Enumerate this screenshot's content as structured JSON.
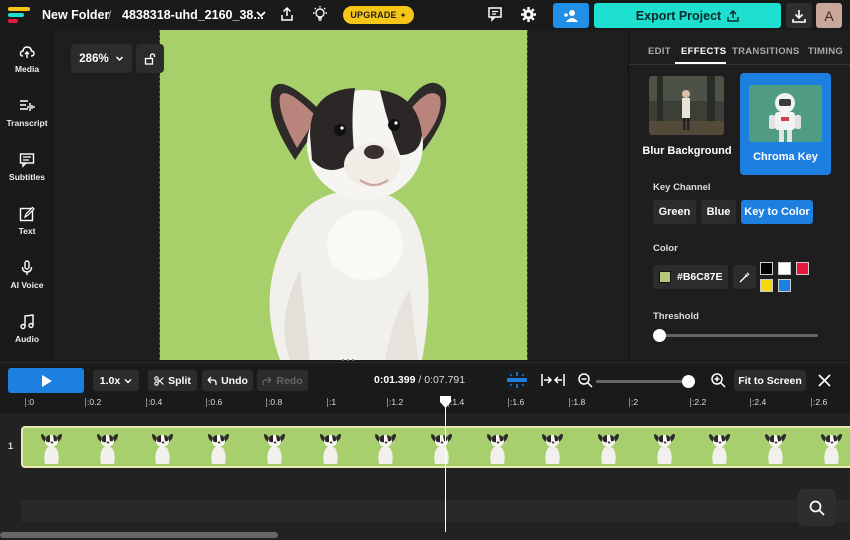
{
  "topbar": {
    "folder": "New Folder",
    "separator": "/",
    "filename": "4838318-uhd_2160_38...",
    "upgrade": "UPGRADE",
    "export": "Export Project",
    "avatar_initial": "A"
  },
  "sidebar": {
    "items": [
      {
        "label": "Media",
        "icon": "upload-cloud-icon"
      },
      {
        "label": "Transcript",
        "icon": "transcript-icon"
      },
      {
        "label": "Subtitles",
        "icon": "subtitles-icon"
      },
      {
        "label": "Text",
        "icon": "text-edit-icon"
      },
      {
        "label": "AI Voice",
        "icon": "microphone-icon"
      },
      {
        "label": "Audio",
        "icon": "music-note-icon"
      }
    ]
  },
  "canvas": {
    "zoom": "286%"
  },
  "panel": {
    "tabs": [
      "EDIT",
      "EFFECTS",
      "TRANSITIONS",
      "TIMING"
    ],
    "active_tab": "EFFECTS",
    "effect1": "Blur Background",
    "effect2": "Chroma Key",
    "key_channel_title": "Key Channel",
    "key_channels": [
      "Green",
      "Blue",
      "Key to Color"
    ],
    "active_channel": "Key to Color",
    "color_title": "Color",
    "color_hex": "#B6C87E",
    "palette": [
      "#000000",
      "#ffffff",
      "#e8193c",
      "#f5d90a",
      "#1d7fe0"
    ],
    "threshold_title": "Threshold",
    "threshold_value": 0.0
  },
  "timeline": {
    "play_label": "",
    "speed": "1.0x",
    "split": "Split",
    "undo": "Undo",
    "redo": "Redo",
    "current_time": "0:01.399",
    "duration": "/ 0:07.791",
    "fit": "Fit to Screen",
    "ruler_ticks": [
      ":0",
      ":0.2",
      ":0.4",
      ":0.6",
      ":0.8",
      ":1",
      ":1.2",
      ":1.4",
      ":1.6",
      ":1.8",
      ":2",
      ":2.2",
      ":2.4",
      ":2.6"
    ],
    "track_number": "1",
    "zoom_level": 0.93
  },
  "colors": {
    "accent_blue": "#1d7fe0",
    "export_cyan": "#1ee0d0",
    "upgrade_yellow": "#f5c518",
    "chroma_green": "#a8d06a"
  }
}
